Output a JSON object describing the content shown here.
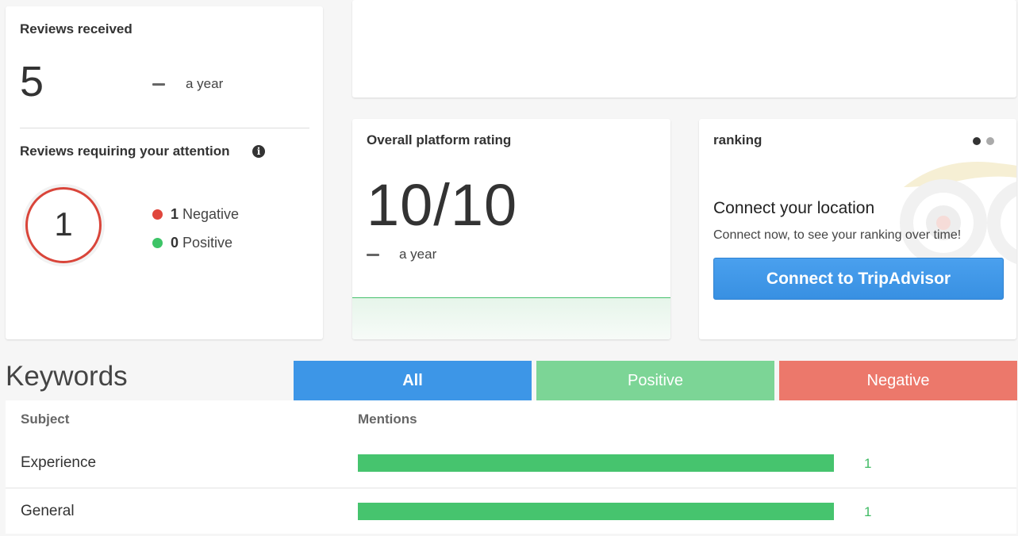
{
  "reviews": {
    "title": "Reviews received",
    "count": "5",
    "period": "a year",
    "attention_title": "Reviews requiring your attention",
    "info_glyph": "i",
    "attention_count": "1",
    "negative_count": "1",
    "negative_label": "Negative",
    "positive_count": "0",
    "positive_label": "Positive"
  },
  "rating": {
    "title": "Overall platform rating",
    "value": "10/10",
    "period": "a year"
  },
  "ranking": {
    "title": "ranking",
    "heading": "Connect your location",
    "subtext": "Connect now, to see your ranking over time!",
    "button_label": "Connect to TripAdvisor"
  },
  "keywords": {
    "title": "Keywords",
    "tabs": [
      "All",
      "Positive",
      "Negative"
    ],
    "active_tab": "All",
    "headers": {
      "subject": "Subject",
      "mentions": "Mentions"
    },
    "rows": [
      {
        "subject": "Experience",
        "mentions": "1",
        "fill": 1.0
      },
      {
        "subject": "General",
        "mentions": "1",
        "fill": 1.0
      }
    ]
  },
  "colors": {
    "accent_blue": "#3d96e7",
    "positive_green": "#46c46e",
    "negative_red": "#d9453a",
    "tab_positive": "#7cd596",
    "tab_negative": "#ec786b"
  },
  "icons": {
    "info": "info-icon",
    "brand": "tripadvisor-owl-icon"
  }
}
